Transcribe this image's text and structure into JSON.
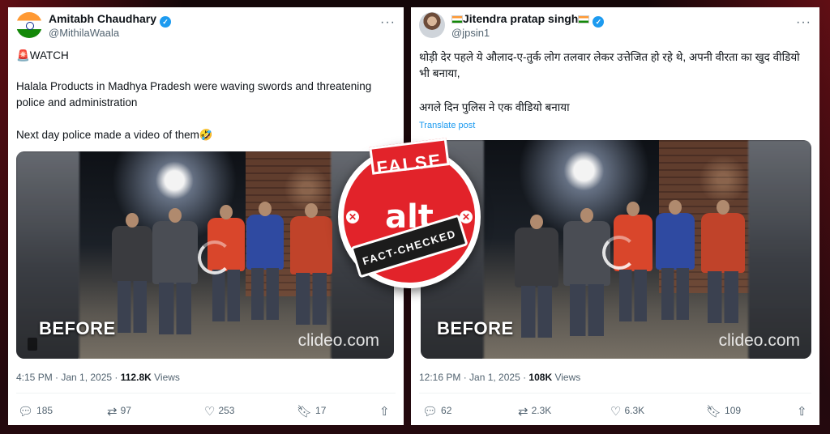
{
  "colors": {
    "accent_blue": "#1d9bf0",
    "badge_red": "#e2232a",
    "text_secondary": "#536471"
  },
  "left_post": {
    "name": "Amitabh Chaudhary",
    "handle": "@MithilaWaala",
    "verified_icon": "verified-badge-icon",
    "lines": [
      "🚨WATCH",
      "Halala Products in Madhya Pradesh were waving swords and threatening police and administration",
      "Next day police made a video of them🤣"
    ],
    "media": {
      "before_label": "BEFORE",
      "watermark": "clideo.com"
    },
    "time": "4:15 PM · Jan 1, 2025 · ",
    "views_count": "112.8K",
    "views_label": " Views",
    "stats": {
      "replies": "185",
      "reposts": "97",
      "likes": "253",
      "bookmarks": "17"
    }
  },
  "right_post": {
    "name": "Jitendra pratap singh",
    "handle": "@jpsin1",
    "verified_icon": "verified-badge-icon",
    "lines": [
      "थोड़ी देर पहले ये औलाद-ए-तुर्क लोग तलवार लेकर उत्तेजित हो रहे थे, अपनी वीरता का खुद वीडियो भी बनाया,",
      "अगले दिन पुलिस ने एक वीडियो बनाया"
    ],
    "translate_label": "Translate post",
    "media": {
      "before_label": "BEFORE",
      "watermark": "clideo.com"
    },
    "time": "12:16 PM · Jan 1, 2025 · ",
    "views_count": "108K",
    "views_label": " Views",
    "stats": {
      "replies": "62",
      "reposts": "2.3K",
      "likes": "6.3K",
      "bookmarks": "109"
    }
  },
  "badge": {
    "top_text": "FALSE",
    "logo_text": "alt",
    "logo_sub": "news",
    "bottom_text": "FACT-CHECKED"
  }
}
